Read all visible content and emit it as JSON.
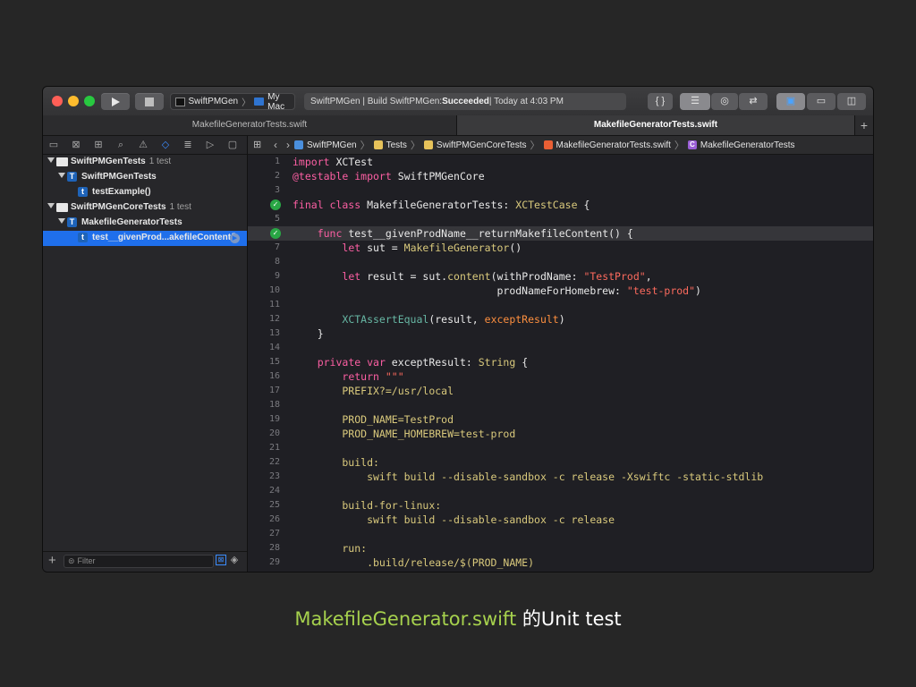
{
  "toolbar": {
    "scheme": "SwiftPMGen",
    "destination": "My Mac",
    "activity_prefix": "SwiftPMGen | Build SwiftPMGen: ",
    "activity_status": "Succeeded",
    "activity_suffix": " | Today at 4:03 PM"
  },
  "tabs": [
    {
      "label": "MakefileGeneratorTests.swift"
    },
    {
      "label": "MakefileGeneratorTests.swift"
    }
  ],
  "navigator": {
    "rows": [
      {
        "label": "SwiftPMGenTests",
        "sub": "1 test"
      },
      {
        "label": "SwiftPMGenTests",
        "sub": ""
      },
      {
        "label": "testExample()",
        "sub": ""
      },
      {
        "label": "SwiftPMGenCoreTests",
        "sub": "1 test"
      },
      {
        "label": "MakefileGeneratorTests",
        "sub": ""
      },
      {
        "label": "test__givenProd...akefileContent()",
        "sub": ""
      }
    ],
    "filter_placeholder": "Filter"
  },
  "jumpbar": {
    "items": [
      "SwiftPMGen",
      "Tests",
      "SwiftPMGenCoreTests",
      "MakefileGeneratorTests.swift",
      "MakefileGeneratorTests"
    ]
  },
  "editor": {
    "line_numbers": [
      "1",
      "2",
      "3",
      "4",
      "5",
      "6",
      "7",
      "8",
      "9",
      "10",
      "11",
      "12",
      "13",
      "14",
      "15",
      "16",
      "17",
      "18",
      "19",
      "20",
      "21",
      "22",
      "23",
      "24",
      "25",
      "26",
      "27",
      "28",
      "29"
    ]
  },
  "caption": {
    "filename": "MakefileGenerator.swift",
    "suffix": " 的Unit test"
  },
  "colors": {
    "accent": "#1f6feb",
    "test_pass": "#29a745",
    "caption_green": "#a6d14d"
  }
}
